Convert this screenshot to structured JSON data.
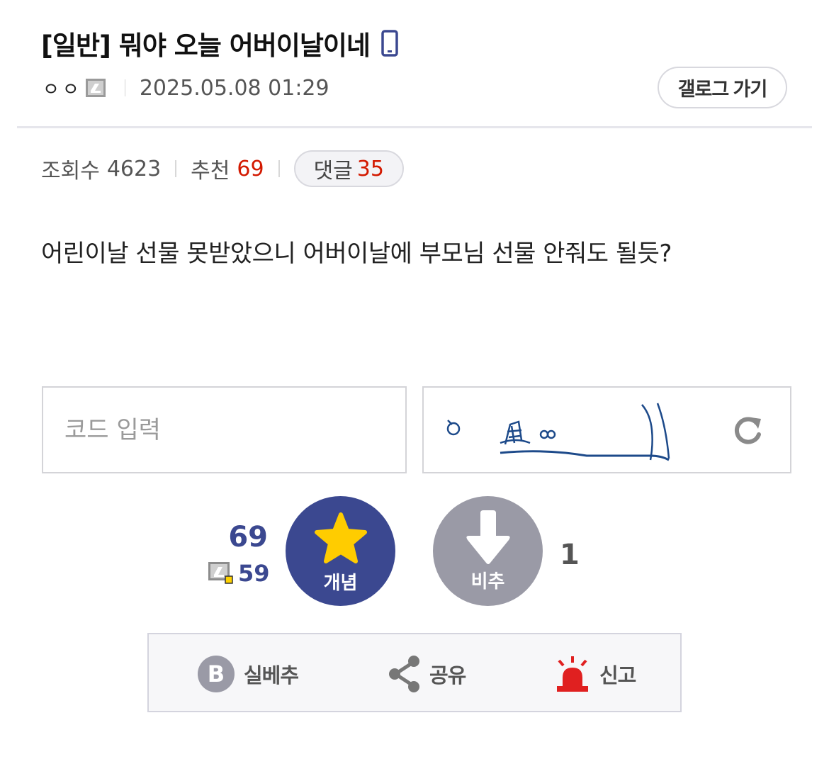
{
  "post": {
    "title": "[일반] 뭐야 오늘 어버이날이네",
    "author_nick": "ㅇㅇ",
    "datetime": "2025.05.08 01:29",
    "gallog_button": "갤로그 가기",
    "views_label": "조회수",
    "views": "4623",
    "recommend_label": "추천",
    "recommend": "69",
    "comments_label": "댓글",
    "comments": "35",
    "body": "어린이날 선물 못받았으니 어버이날에 부모님 선물 안줘도 될듯?"
  },
  "captcha": {
    "placeholder": "코드 입력"
  },
  "vote": {
    "up_count": "69",
    "fixed_up_count": "59",
    "up_label": "개념",
    "down_label": "비추",
    "down_count": "1"
  },
  "actions": {
    "best_label": "실베추",
    "share_label": "공유",
    "report_label": "신고"
  },
  "colors": {
    "accent": "#3b4890",
    "red": "#d31900",
    "star": "#ffcc00",
    "report_red": "#e02020"
  },
  "icons": [
    "mobile-icon",
    "fixed-nick-icon",
    "refresh-icon",
    "star-icon",
    "arrow-down-icon",
    "best-b-icon",
    "share-icon",
    "siren-icon"
  ]
}
